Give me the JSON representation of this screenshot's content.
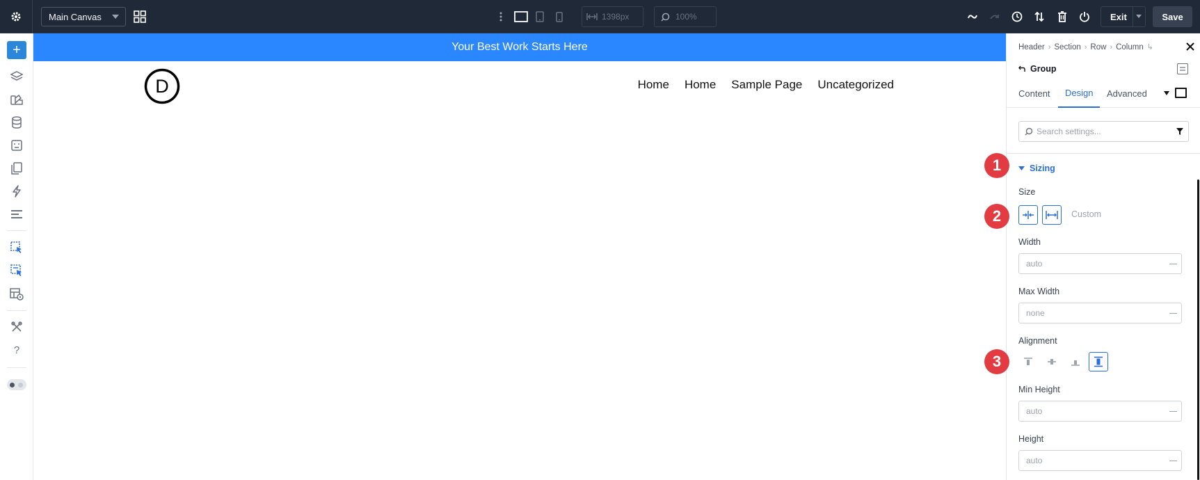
{
  "toolbar": {
    "canvas_select": "Main Canvas",
    "width_value": "1398px",
    "zoom_value": "100%",
    "exit_label": "Exit",
    "save_label": "Save"
  },
  "canvas": {
    "banner_text": "Your Best Work Starts Here",
    "logo_letter": "D",
    "nav_items": [
      "Home",
      "Home",
      "Sample Page",
      "Uncategorized"
    ]
  },
  "panel": {
    "breadcrumbs": [
      "Header",
      "Section",
      "Row",
      "Column"
    ],
    "group_label": "Group",
    "tabs": [
      "Content",
      "Design",
      "Advanced"
    ],
    "search_placeholder": "Search settings...",
    "section_title": "Sizing",
    "size_label": "Size",
    "size_custom": "Custom",
    "width_label": "Width",
    "width_value": "auto",
    "max_width_label": "Max Width",
    "max_width_value": "none",
    "alignment_label": "Alignment",
    "min_height_label": "Min Height",
    "min_height_value": "auto",
    "height_label": "Height",
    "height_value": "auto"
  },
  "badges": [
    "1",
    "2",
    "3"
  ],
  "colors": {
    "topbar": "#1f2937",
    "accent": "#2b87da",
    "banner": "#2b87ff",
    "panel_accent": "#2b6fd6",
    "badge": "#e23b41"
  }
}
